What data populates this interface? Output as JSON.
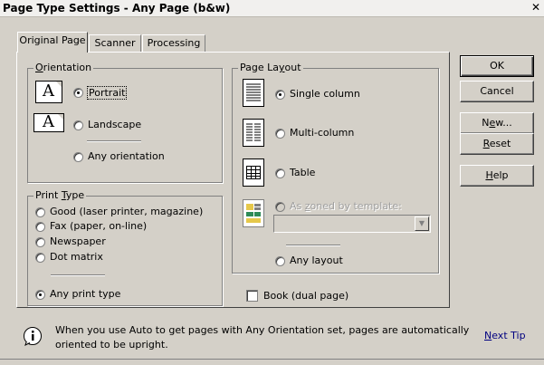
{
  "window": {
    "title": "Page Type Settings - Any Page (b&w)",
    "close_glyph": "✕"
  },
  "tabs": [
    {
      "label": "Original Page",
      "active": true
    },
    {
      "label": "Scanner",
      "active": false
    },
    {
      "label": "Processing",
      "active": false
    }
  ],
  "orientation": {
    "legend_underlined": "O",
    "legend_rest": "rientation",
    "portrait": "Portrait",
    "landscape": "Landscape",
    "any": "Any orientation",
    "selected": "portrait"
  },
  "print_type": {
    "legend_pre": "Print ",
    "legend_underlined": "T",
    "legend_rest": "ype",
    "options": [
      "Good (laser printer, magazine)",
      "Fax (paper, on-line)",
      "Newspaper",
      "Dot matrix"
    ],
    "any": "Any print type",
    "selected": "any"
  },
  "page_layout": {
    "legend_pre": "Page La",
    "legend_underlined": "y",
    "legend_rest": "out",
    "single": "Single column",
    "multi": "Multi-column",
    "table": "Table",
    "zoned_pre": "As ",
    "zoned_underlined": "z",
    "zoned_rest": "oned by template:",
    "any": "Any layout",
    "selected": "single"
  },
  "book": {
    "label": "Book (dual page)",
    "checked": false
  },
  "buttons": {
    "ok": "OK",
    "cancel": "Cancel",
    "new_pre": "N",
    "new_underlined": "e",
    "new_rest": "w...",
    "reset_underlined": "R",
    "reset_rest": "eset",
    "help_underlined": "H",
    "help_rest": "elp"
  },
  "tip": {
    "line1": "When you use Auto to get pages with Any Orientation set, pages are automatically",
    "line2": "oriented to be upright.",
    "next_underlined": "N",
    "next_rest": "ext Tip"
  },
  "icons": {
    "letter_a": "A"
  },
  "colors": {
    "tip_link": "#000080",
    "highlight_green": "#2e8b57",
    "highlight_yellow": "#e6c84b"
  }
}
